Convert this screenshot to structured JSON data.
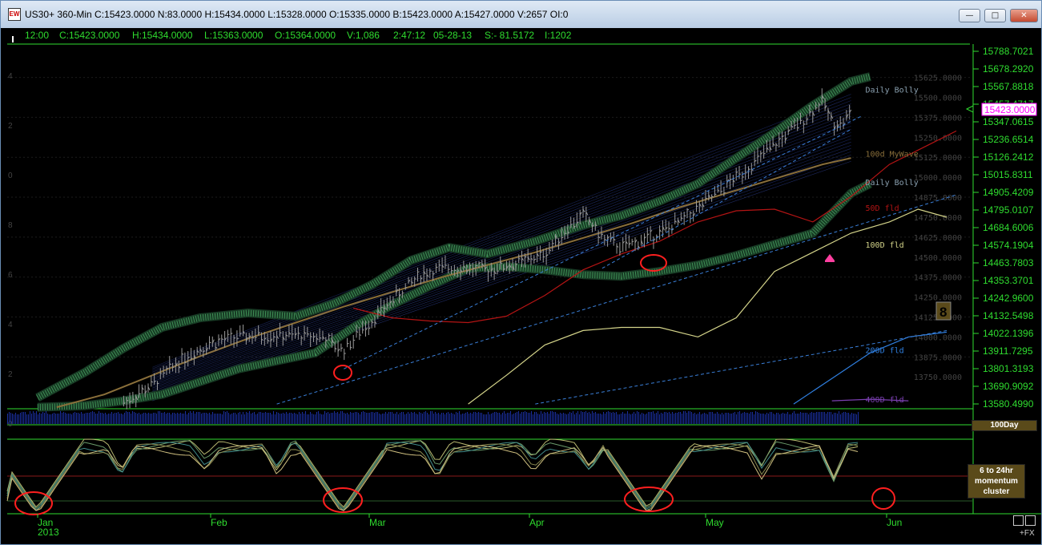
{
  "window": {
    "title": "US30+ 360-Min C:15423.0000 N:83.0000 H:15434.0000 L:15328.0000 O:15335.0000 B:15423.0000 A:15427.0000 V:2657 OI:0",
    "icon_label": "EW",
    "minimize_label": "—",
    "maximize_label": "□",
    "close_label": "✕"
  },
  "infobar": {
    "time": "12:00",
    "close": "C:15423.0000",
    "high": "H:15434.0000",
    "low": "L:15363.0000",
    "open": "O:15364.0000",
    "volume": "V:1,086",
    "clock": "2:47:12",
    "date": "05-28-13",
    "s": "S:- 81.5172",
    "i": "I:1202"
  },
  "chart_data": {
    "type": "line",
    "symbol": "US30+",
    "interval": "360-Min",
    "price_axis": {
      "ticks": [
        "15788.7021",
        "15678.2920",
        "15567.8818",
        "15457.4717",
        "15347.0615",
        "15236.6514",
        "15126.2412",
        "15015.8311",
        "14905.4209",
        "14795.0107",
        "14684.6006",
        "14574.1904",
        "14463.7803",
        "14353.3701",
        "14242.9600",
        "14132.5498",
        "14022.1396",
        "13911.7295",
        "13801.3193",
        "13690.9092",
        "13580.4990"
      ],
      "range": [
        13580.499,
        15788.7021
      ],
      "last_price": "15423.0000"
    },
    "left_axis_digits": [
      "4",
      "2",
      "0",
      "8",
      "6",
      "4",
      "2",
      "0"
    ],
    "inner_levels": [
      "15625.0000",
      "15500.0000",
      "15375.0000",
      "15250.0000",
      "15125.0000",
      "15000.0000",
      "14875.0000",
      "14750.0000",
      "14625.0000",
      "14500.0000",
      "14375.0000",
      "14250.0000",
      "14125.0000",
      "14000.0000",
      "13875.0000",
      "13750.0000"
    ],
    "time_axis": {
      "labels": [
        "Jan",
        "Feb",
        "Mar",
        "Apr",
        "May",
        "Jun"
      ],
      "year_label": "2013"
    },
    "x_range": [
      0,
      100
    ],
    "series": [
      {
        "name": "Daily Bolly",
        "color": "#3f8f55",
        "values": [
          [
            3,
            13620
          ],
          [
            8,
            13780
          ],
          [
            12,
            13930
          ],
          [
            16,
            14060
          ],
          [
            20,
            14120
          ],
          [
            25,
            14150
          ],
          [
            30,
            14130
          ],
          [
            34,
            14210
          ],
          [
            38,
            14330
          ],
          [
            42,
            14480
          ],
          [
            46,
            14560
          ],
          [
            50,
            14520
          ],
          [
            55,
            14600
          ],
          [
            60,
            14700
          ],
          [
            64,
            14760
          ],
          [
            68,
            14850
          ],
          [
            72,
            14960
          ],
          [
            76,
            15120
          ],
          [
            80,
            15280
          ],
          [
            84,
            15450
          ],
          [
            88,
            15600
          ],
          [
            90,
            15630
          ]
        ]
      },
      {
        "name": "Daily Bolly",
        "color": "#3f8f55",
        "values": [
          [
            3,
            13560
          ],
          [
            8,
            13570
          ],
          [
            12,
            13600
          ],
          [
            16,
            13640
          ],
          [
            20,
            13720
          ],
          [
            24,
            13800
          ],
          [
            28,
            13850
          ],
          [
            32,
            13900
          ],
          [
            36,
            14060
          ],
          [
            40,
            14200
          ],
          [
            44,
            14320
          ],
          [
            48,
            14430
          ],
          [
            52,
            14440
          ],
          [
            56,
            14420
          ],
          [
            60,
            14390
          ],
          [
            64,
            14380
          ],
          [
            68,
            14410
          ],
          [
            72,
            14450
          ],
          [
            76,
            14510
          ],
          [
            80,
            14580
          ],
          [
            84,
            14650
          ],
          [
            88,
            14900
          ],
          [
            90,
            14960
          ]
        ]
      },
      {
        "name": "100d MyWave",
        "color": "#8a6f3a",
        "values": [
          [
            5,
            13560
          ],
          [
            10,
            13640
          ],
          [
            15,
            13760
          ],
          [
            20,
            13880
          ],
          [
            25,
            13990
          ],
          [
            30,
            14090
          ],
          [
            35,
            14190
          ],
          [
            40,
            14280
          ],
          [
            45,
            14370
          ],
          [
            50,
            14450
          ],
          [
            55,
            14530
          ],
          [
            60,
            14620
          ],
          [
            65,
            14710
          ],
          [
            70,
            14810
          ],
          [
            75,
            14900
          ],
          [
            80,
            14990
          ],
          [
            85,
            15080
          ],
          [
            88,
            15120
          ]
        ]
      },
      {
        "name": "50D fld",
        "color": "#b41414",
        "values": [
          [
            36,
            14180
          ],
          [
            40,
            14120
          ],
          [
            44,
            14100
          ],
          [
            48,
            14090
          ],
          [
            52,
            14130
          ],
          [
            56,
            14260
          ],
          [
            60,
            14420
          ],
          [
            64,
            14520
          ],
          [
            68,
            14600
          ],
          [
            72,
            14720
          ],
          [
            76,
            14790
          ],
          [
            80,
            14800
          ],
          [
            84,
            14720
          ],
          [
            88,
            14880
          ],
          [
            92,
            15080
          ],
          [
            96,
            15200
          ],
          [
            99,
            15290
          ]
        ]
      },
      {
        "name": "100D fld",
        "color": "#d4d48a",
        "values": [
          [
            48,
            13580
          ],
          [
            52,
            13760
          ],
          [
            56,
            13950
          ],
          [
            60,
            14040
          ],
          [
            64,
            14060
          ],
          [
            68,
            14060
          ],
          [
            72,
            14000
          ],
          [
            76,
            14120
          ],
          [
            80,
            14410
          ],
          [
            84,
            14530
          ],
          [
            88,
            14650
          ],
          [
            92,
            14720
          ],
          [
            95,
            14800
          ],
          [
            98,
            14750
          ]
        ]
      },
      {
        "name": "200D fld",
        "color": "#2f7fe0",
        "values": [
          [
            82,
            13580
          ],
          [
            86,
            13740
          ],
          [
            90,
            13900
          ],
          [
            94,
            14000
          ],
          [
            98,
            14030
          ]
        ]
      },
      {
        "name": "400D fld",
        "color": "#7a3fb0",
        "values": [
          [
            86,
            13600
          ],
          [
            90,
            13610
          ],
          [
            94,
            13600
          ]
        ]
      }
    ],
    "annotations": {
      "cycle_count": "8",
      "volume_panel_label": "100Day",
      "momentum_panel_label": "6 to 24hr momentum cluster"
    }
  },
  "footer": {
    "fx_label": "+FX"
  },
  "colors": {
    "axis_green": "#2fdc2f",
    "last_price_magenta": "#ff00ff",
    "circle_red": "#ff1f1f",
    "volume_blue": "#1a2fa0",
    "box_brown": "#5a4a1a"
  }
}
